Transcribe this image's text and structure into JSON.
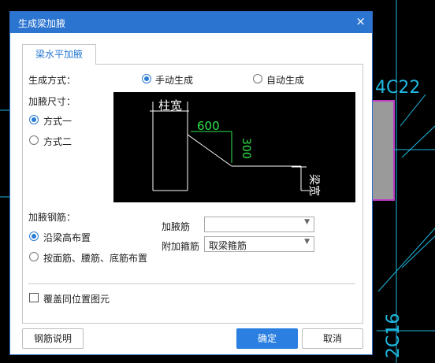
{
  "dialog": {
    "title": "生成梁加腋",
    "close_glyph": "×",
    "tab_label": "梁水平加腋",
    "gen_mode_label": "生成方式：",
    "gen_manual": "手动生成",
    "gen_auto": "自动生成",
    "size_label": "加腋尺寸：",
    "size_opt1": "方式一",
    "size_opt2": "方式二",
    "rebar_label": "加腋钢筋：",
    "rebar_opt1": "沿梁高布置",
    "rebar_opt2": "按面筋、腰筋、底筋布置",
    "haunch_rebar_label": "加腋筋",
    "haunch_rebar_value": "",
    "extra_stirrup_label": "附加箍筋",
    "extra_stirrup_value": "取梁箍筋",
    "cover_checkbox_label": "覆盖同位置图元",
    "help_button": "钢筋说明",
    "ok_button": "确定",
    "cancel_button": "取消"
  },
  "diagram": {
    "column_width_label": "柱宽",
    "dim_600": "600",
    "dim_300": "300",
    "beam_width_label": "梁宽"
  },
  "background": {
    "cad_text": "4C22",
    "cad_side_text": "2C16"
  },
  "colors": {
    "accent": "#2b74d0",
    "cad_cyan": "#1fb8e0",
    "cad_magenta": "#c03cc8",
    "dim_green": "#2ee64a"
  }
}
